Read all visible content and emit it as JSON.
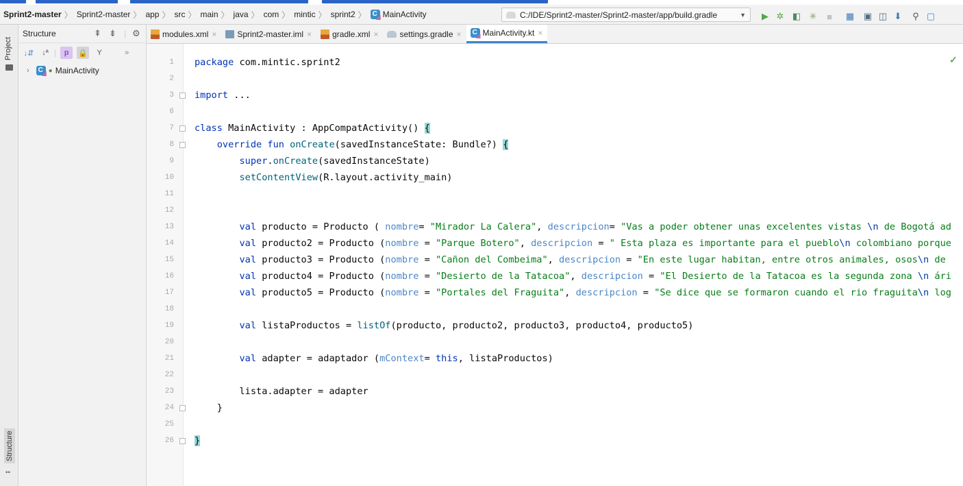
{
  "navbar": {
    "breadcrumbs": [
      "Sprint2-master",
      "Sprint2-master",
      "app",
      "src",
      "main",
      "java",
      "com",
      "mintic",
      "sprint2",
      "MainActivity"
    ],
    "run_config": "C:/IDE/Sprint2-master/Sprint2-master/app/build.gradle",
    "toolbar_icons": [
      "run-icon",
      "debug-icon",
      "attach-debugger-icon",
      "profile-icon",
      "stop-icon",
      "gradle-sync-icon",
      "avd-manager-icon",
      "device-manager-icon",
      "sdk-manager-icon",
      "search-icon"
    ]
  },
  "left_strip": {
    "project_label": "Project",
    "structure_label": "Structure"
  },
  "structure": {
    "title": "Structure",
    "tree_item": "MainActivity"
  },
  "tabs": [
    {
      "label": "modules.xml",
      "icon": "xml-file-icon",
      "active": false
    },
    {
      "label": "Sprint2-master.iml",
      "icon": "iml-file-icon",
      "active": false
    },
    {
      "label": "gradle.xml",
      "icon": "xml-file-icon",
      "active": false
    },
    {
      "label": "settings.gradle",
      "icon": "gradle-file-icon",
      "active": false
    },
    {
      "label": "MainActivity.kt",
      "icon": "kotlin-class-icon",
      "active": true
    }
  ],
  "editor": {
    "line_numbers": [
      "1",
      "2",
      "3",
      "6",
      "7",
      "8",
      "9",
      "10",
      "11",
      "12",
      "13",
      "14",
      "15",
      "16",
      "17",
      "18",
      "19",
      "20",
      "21",
      "22",
      "23",
      "24",
      "25",
      "26"
    ],
    "code_lines": [
      "package com.mintic.sprint2",
      "",
      "import ...",
      "",
      "class MainActivity : AppCompatActivity() {",
      "    override fun onCreate(savedInstanceState: Bundle?) {",
      "        super.onCreate(savedInstanceState)",
      "        setContentView(R.layout.activity_main)",
      "",
      "",
      "        val producto = Producto ( nombre= \"Mirador La Calera\", descripcion= \"Vas a poder obtener unas excelentes vistas \\n de Bogotá ad",
      "        val producto2 = Producto (nombre = \"Parque Botero\", descripcion = \" Esta plaza es importante para el pueblo\\n colombiano porque",
      "        val producto3 = Producto (nombre = \"Cañon del Combeima\", descripcion = \"En este lugar habitan, entre otros animales, osos\\n de",
      "        val producto4 = Producto (nombre = \"Desierto de la Tatacoa\", descripcion = \"El Desierto de la Tatacoa es la segunda zona \\n ári",
      "        val producto5 = Producto (nombre = \"Portales del Fraguita\", descripcion = \"Se dice que se formaron cuando el rio fraguita\\n log",
      "",
      "        val listaProductos = listOf(producto, producto2, producto3, producto4, producto5)",
      "",
      "        val adapter = adaptador (mContext= this, listaProductos)",
      "",
      "        lista.adapter = adapter",
      "    }",
      "",
      "}"
    ],
    "status_icon": "check-icon"
  }
}
